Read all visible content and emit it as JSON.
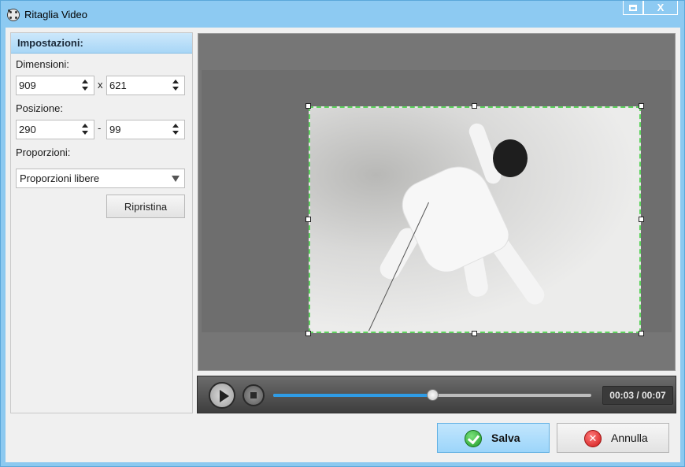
{
  "window": {
    "title": "Ritaglia Video",
    "close_glyph": "X"
  },
  "settings": {
    "header": "Impostazioni:",
    "dimensions_label": "Dimensioni:",
    "width": "909",
    "dim_separator": "x",
    "height": "621",
    "position_label": "Posizione:",
    "pos_x": "290",
    "pos_separator": "-",
    "pos_y": "99",
    "ratio_label": "Proporzioni:",
    "ratio_value": "Proporzioni libere",
    "reset_label": "Ripristina"
  },
  "player": {
    "timecode": "00:03 / 00:07",
    "progress": 0.5
  },
  "actions": {
    "save_label": "Salva",
    "cancel_label": "Annulla",
    "x_glyph": "✕"
  },
  "colors": {
    "titlebar": "#8dcaf2",
    "crop_border": "#5cd35c",
    "progress_fill": "#2f9ce6"
  }
}
